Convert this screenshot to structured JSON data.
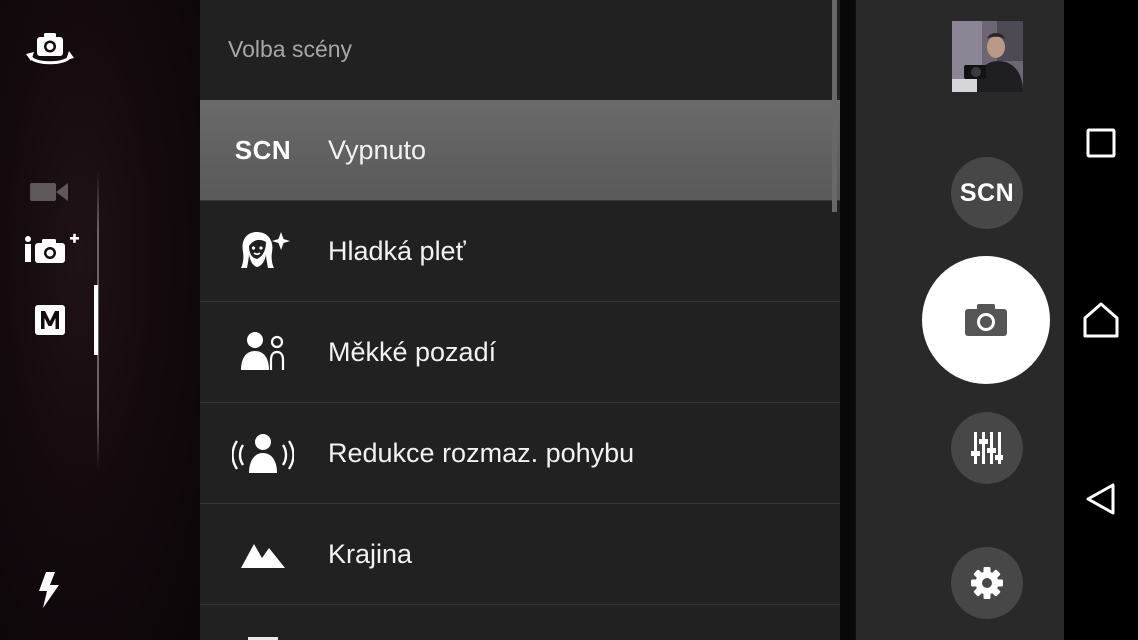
{
  "scene_menu": {
    "title": "Volba scény",
    "items": [
      {
        "label": "Vypnuto",
        "icon": "scn-text-icon",
        "icon_text": "SCN",
        "selected": true
      },
      {
        "label": "Hladká pleť",
        "icon": "soft-skin-face-icon",
        "selected": false
      },
      {
        "label": "Měkké pozadí",
        "icon": "soft-background-person-icon",
        "selected": false
      },
      {
        "label": "Redukce rozmaz. pohybu",
        "icon": "anti-motion-blur-icon",
        "selected": false
      },
      {
        "label": "Krajina",
        "icon": "landscape-mountain-icon",
        "selected": false
      }
    ]
  },
  "left_controls": {
    "switch_camera": "switch-camera-icon",
    "modes": [
      {
        "name": "video",
        "icon": "video-camera-icon"
      },
      {
        "name": "superior-auto",
        "icon": "intelligent-auto-icon"
      },
      {
        "name": "manual",
        "icon": "manual-mode-icon",
        "label": "M",
        "active": true
      }
    ],
    "flash": "flash-icon"
  },
  "right_controls": {
    "scene_button_label": "SCN",
    "shutter": "camera-icon",
    "settings_sliders": "sliders-icon",
    "settings": "gear-icon"
  },
  "nav": {
    "recents": "square-recents-icon",
    "home": "home-icon",
    "back": "back-triangle-icon"
  },
  "colors": {
    "menu_bg": "#212121",
    "selected_bg": "#626262",
    "right_panel_bg": "#292929",
    "button_bg": "#474747"
  }
}
